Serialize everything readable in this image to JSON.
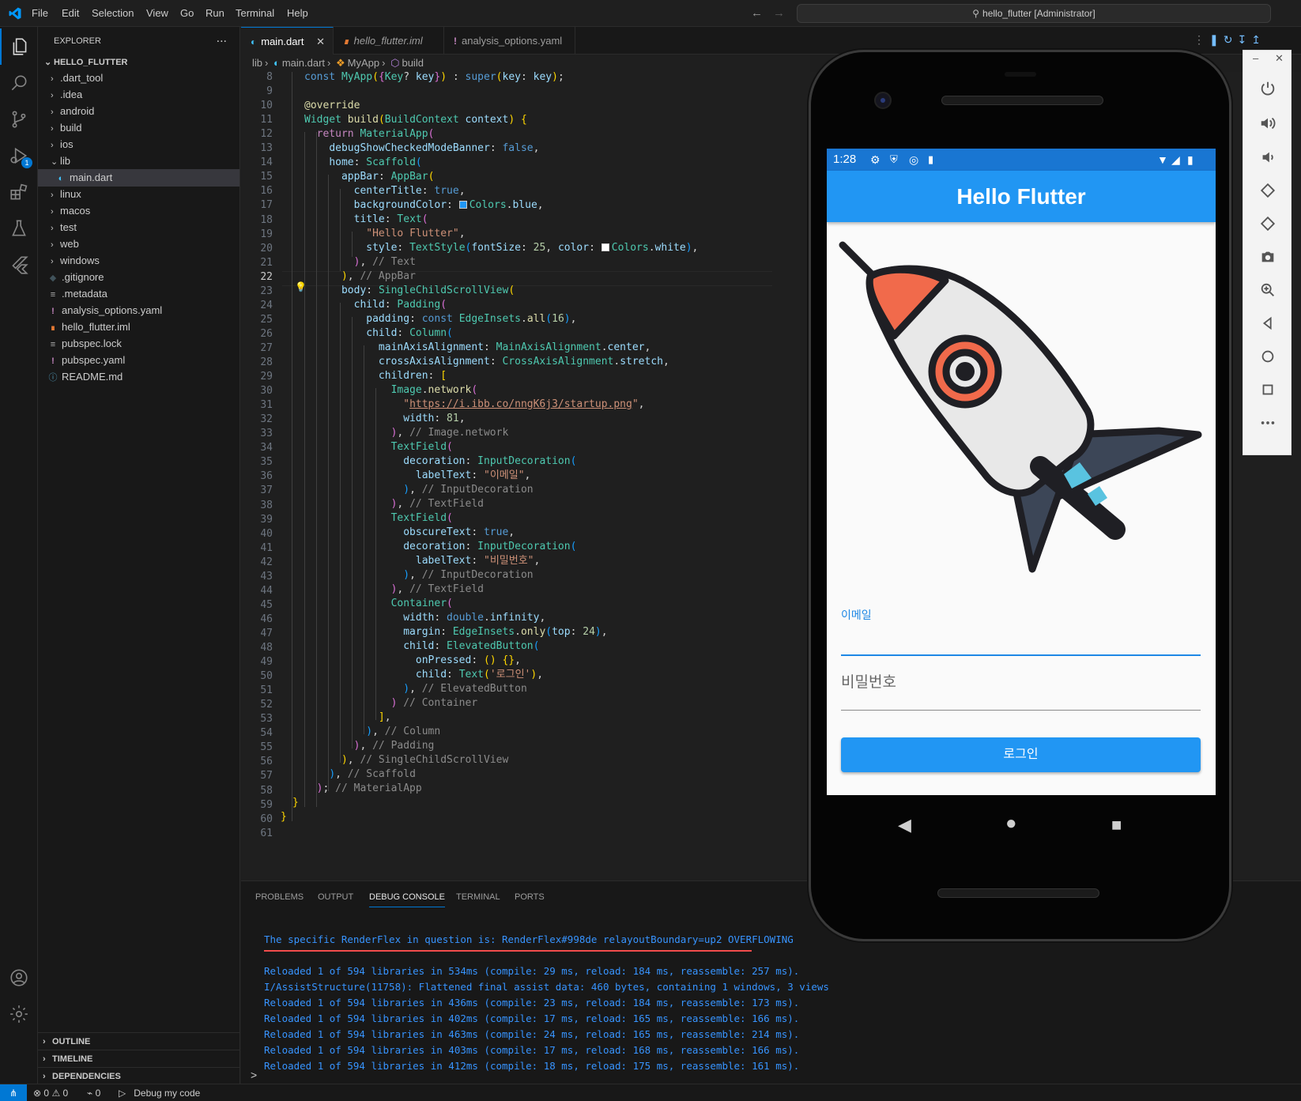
{
  "titlebar": {
    "menu": [
      "File",
      "Edit",
      "Selection",
      "View",
      "Go",
      "Run",
      "Terminal",
      "Help"
    ],
    "command_center": "hello_flutter [Administrator]"
  },
  "activity": {
    "run_badge": "1"
  },
  "sidebar": {
    "title": "EXPLORER",
    "more": "...",
    "root": "HELLO_FLUTTER",
    "items": [
      {
        "label": ".dart_tool",
        "type": "folder"
      },
      {
        "label": ".idea",
        "type": "folder"
      },
      {
        "label": "android",
        "type": "folder"
      },
      {
        "label": "build",
        "type": "folder"
      },
      {
        "label": "ios",
        "type": "folder"
      },
      {
        "label": "lib",
        "type": "folder-open"
      },
      {
        "label": "main.dart",
        "type": "dart"
      },
      {
        "label": "linux",
        "type": "folder"
      },
      {
        "label": "macos",
        "type": "folder"
      },
      {
        "label": "test",
        "type": "folder"
      },
      {
        "label": "web",
        "type": "folder"
      },
      {
        "label": "windows",
        "type": "folder"
      },
      {
        "label": ".gitignore",
        "type": "git"
      },
      {
        "label": ".metadata",
        "type": "text"
      },
      {
        "label": "analysis_options.yaml",
        "type": "yaml"
      },
      {
        "label": "hello_flutter.iml",
        "type": "rss"
      },
      {
        "label": "pubspec.lock",
        "type": "text"
      },
      {
        "label": "pubspec.yaml",
        "type": "yaml"
      },
      {
        "label": "README.md",
        "type": "info"
      }
    ],
    "sections": [
      "OUTLINE",
      "TIMELINE",
      "DEPENDENCIES"
    ]
  },
  "tabs": [
    {
      "label": "main.dart",
      "active": true
    },
    {
      "label": "hello_flutter.iml",
      "active": false
    },
    {
      "label": "analysis_options.yaml",
      "active": false
    }
  ],
  "breadcrumb": [
    "lib",
    "main.dart",
    "MyApp",
    "build"
  ],
  "editor": {
    "current_line": 22,
    "line_numbers": [
      8,
      9,
      10,
      11,
      12,
      13,
      14,
      15,
      16,
      17,
      18,
      19,
      20,
      21,
      22,
      23,
      24,
      25,
      26,
      27,
      28,
      29,
      30,
      31,
      32,
      33,
      34,
      35,
      36,
      37,
      38,
      39,
      40,
      41,
      42,
      43,
      44,
      45,
      46,
      47,
      48,
      49,
      50,
      51,
      52,
      53,
      54,
      55,
      56,
      57,
      58,
      59,
      60,
      61
    ]
  },
  "panel": {
    "tabs": [
      "PROBLEMS",
      "OUTPUT",
      "DEBUG CONSOLE",
      "TERMINAL",
      "PORTS"
    ],
    "active_tab": "DEBUG CONSOLE",
    "lines": [
      "The specific RenderFlex in question is: RenderFlex#998de relayoutBoundary=up2 OVERFLOWING",
      "Reloaded 1 of 594 libraries in 534ms (compile: 29 ms, reload: 184 ms, reassemble: 257 ms).",
      "I/AssistStructure(11758): Flattened final assist data: 460 bytes, containing 1 windows, 3 views",
      "Reloaded 1 of 594 libraries in 436ms (compile: 23 ms, reload: 184 ms, reassemble: 173 ms).",
      "Reloaded 1 of 594 libraries in 402ms (compile: 17 ms, reload: 165 ms, reassemble: 166 ms).",
      "Reloaded 1 of 594 libraries in 463ms (compile: 24 ms, reload: 165 ms, reassemble: 214 ms).",
      "Reloaded 1 of 594 libraries in 403ms (compile: 17 ms, reload: 168 ms, reassemble: 166 ms).",
      "Reloaded 1 of 594 libraries in 412ms (compile: 18 ms, reload: 175 ms, reassemble: 161 ms)."
    ],
    "prompt": ">"
  },
  "statusbar": {
    "errors": "0",
    "warnings": "0",
    "ports": "0",
    "debug": "Debug my code"
  },
  "phone": {
    "time": "1:28",
    "app_title": "Hello Flutter",
    "email_label": "이메일",
    "password_label": "비밀번호",
    "login_button": "로그인"
  },
  "colors": {
    "accent": "#0078d4",
    "app_bar": "#2196f3",
    "status_bar": "#1976d2",
    "console_text": "#3794ff"
  }
}
